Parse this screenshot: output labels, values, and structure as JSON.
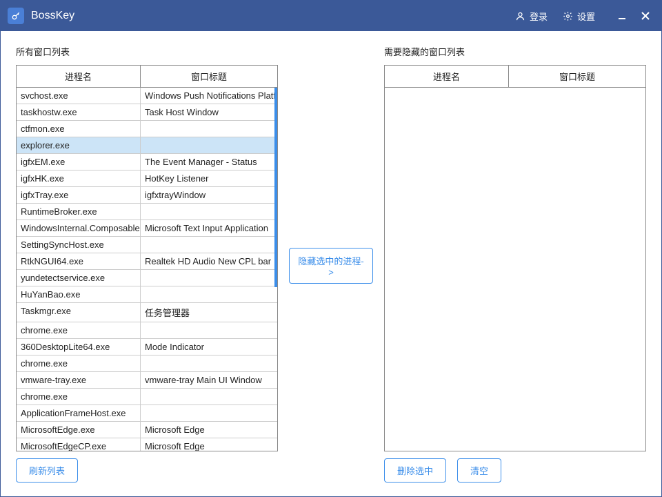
{
  "titlebar": {
    "app_name": "BossKey",
    "login_label": "登录",
    "settings_label": "设置"
  },
  "left_panel": {
    "label": "所有窗口列表",
    "col_process": "进程名",
    "col_title": "窗口标题",
    "refresh_btn": "刷新列表",
    "selected_index": 3,
    "rows": [
      {
        "process": "svchost.exe",
        "title": "Windows Push Notifications Platform"
      },
      {
        "process": "taskhostw.exe",
        "title": "Task Host Window"
      },
      {
        "process": "ctfmon.exe",
        "title": ""
      },
      {
        "process": "explorer.exe",
        "title": ""
      },
      {
        "process": "igfxEM.exe",
        "title": "The Event Manager - Status"
      },
      {
        "process": "igfxHK.exe",
        "title": "HotKey Listener"
      },
      {
        "process": "igfxTray.exe",
        "title": "igfxtrayWindow"
      },
      {
        "process": "RuntimeBroker.exe",
        "title": ""
      },
      {
        "process": "WindowsInternal.ComposableShell",
        "title": "Microsoft Text Input Application"
      },
      {
        "process": "SettingSyncHost.exe",
        "title": ""
      },
      {
        "process": "RtkNGUI64.exe",
        "title": "Realtek HD Audio New CPL bar"
      },
      {
        "process": "yundetectservice.exe",
        "title": ""
      },
      {
        "process": "HuYanBao.exe",
        "title": ""
      },
      {
        "process": "Taskmgr.exe",
        "title": "任务管理器"
      },
      {
        "process": "chrome.exe",
        "title": ""
      },
      {
        "process": "360DesktopLite64.exe",
        "title": "Mode Indicator"
      },
      {
        "process": "chrome.exe",
        "title": ""
      },
      {
        "process": "vmware-tray.exe",
        "title": "vmware-tray Main UI Window"
      },
      {
        "process": "chrome.exe",
        "title": ""
      },
      {
        "process": "ApplicationFrameHost.exe",
        "title": ""
      },
      {
        "process": "MicrosoftEdge.exe",
        "title": "Microsoft Edge"
      },
      {
        "process": "MicrosoftEdgeCP.exe",
        "title": "Microsoft Edge"
      }
    ]
  },
  "middle": {
    "move_btn": "隐藏选中的进程->"
  },
  "right_panel": {
    "label": "需要隐藏的窗口列表",
    "col_process": "进程名",
    "col_title": "窗口标题",
    "delete_btn": "删除选中",
    "clear_btn": "清空",
    "rows": []
  }
}
